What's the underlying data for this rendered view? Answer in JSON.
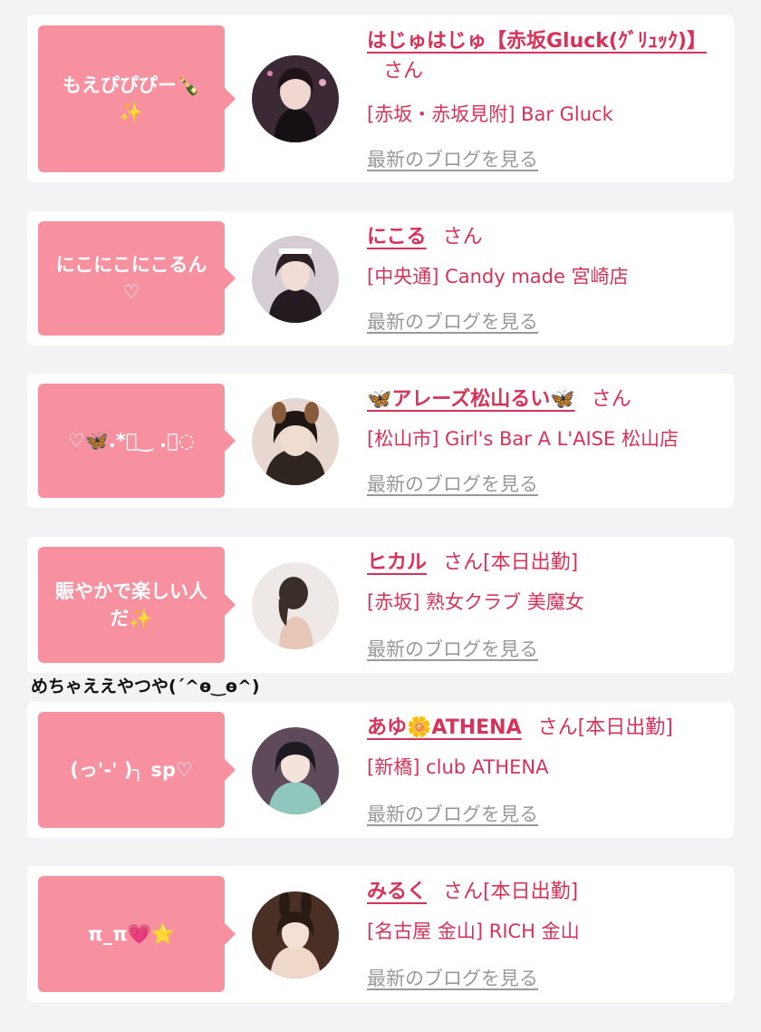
{
  "entries": [
    {
      "bubble": "もえぴぴぴー🍾\n✨",
      "name": "はじゅはじゅ【赤坂Gluck(ｸﾞﾘｭｯｸ)】",
      "san": "さん",
      "status": "",
      "shop": "[赤坂・赤坂見附] Bar Gluck",
      "blog": "最新のブログを見る",
      "avatar_colors": [
        "#5a3a4a",
        "#1c1418",
        "#c98aa0"
      ]
    },
    {
      "bubble": "にこにこにこるん\n♡",
      "name": "にこる",
      "san": "さん",
      "status": "",
      "shop": "[中央通] Candy made 宮崎店",
      "blog": "最新のブログを見る",
      "avatar_colors": [
        "#d8cfd6",
        "#2a2026",
        "#e6c4c0"
      ]
    },
    {
      "bubble": "♡🦋.*ﾟ‿ .ﾟ◌",
      "name": "🦋アレーズ松山るい🦋",
      "san": "さん",
      "status": "",
      "shop": "[松山市] Girl's Bar A L'AISE 松山店",
      "blog": "最新のブログを見る",
      "avatar_colors": [
        "#3a2c26",
        "#e8d6cc",
        "#8a5a3c"
      ]
    },
    {
      "bubble": "賑やかで楽しい人\nだ✨",
      "name": "ヒカル",
      "san": "さん",
      "status": "[本日出勤]",
      "shop": "[赤坂] 熟女クラブ 美魔女",
      "blog": "最新のブログを見る",
      "avatar_colors": [
        "#ece6e4",
        "#3a2e2a",
        "#e4c2b0"
      ]
    },
    {
      "bubble": "(っ'-' )╮ sp♡",
      "name": "あゆ🌼ATHENA",
      "san": "さん",
      "status": "[本日出勤]",
      "shop": "[新橋] club ATHENA",
      "blog": "最新のブログを見る",
      "avatar_colors": [
        "#6a5060",
        "#1e1a22",
        "#8fc6be"
      ]
    },
    {
      "bubble": "π_π💗⭐",
      "name": "みるく",
      "san": "さん",
      "status": "[本日出勤]",
      "shop": "[名古屋 金山] RICH 金山",
      "blog": "最新のブログを見る",
      "avatar_colors": [
        "#5a3a2a",
        "#2a1a14",
        "#f0d8c8"
      ]
    }
  ],
  "floating_text": "めちゃええやつや(ˊ^ө‿ө^)"
}
